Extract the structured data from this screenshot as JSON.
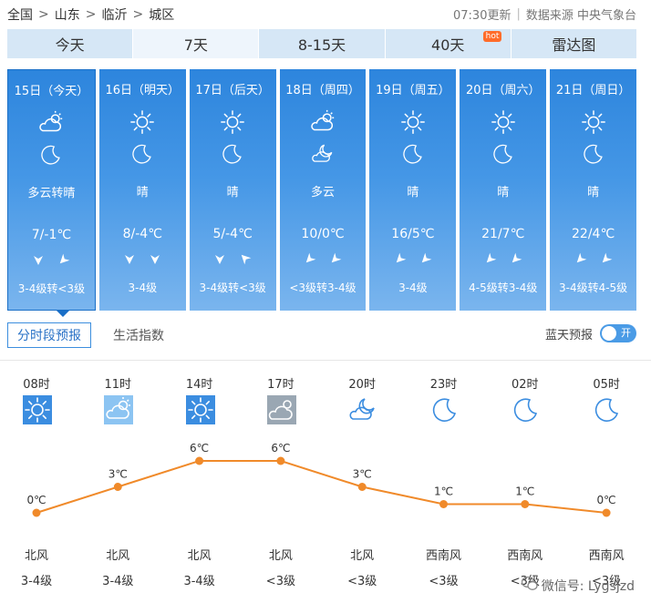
{
  "breadcrumb": {
    "country": "全国",
    "province": "山东",
    "city": "临沂",
    "district": "城区",
    "sep": ">"
  },
  "source": {
    "updated": "07:30更新",
    "text": "数据来源 中央气象台",
    "sep": "|"
  },
  "tabs": [
    {
      "label": "今天"
    },
    {
      "label": "7天"
    },
    {
      "label": "8-15天"
    },
    {
      "label": "40天",
      "badge": "hot"
    },
    {
      "label": "雷达图"
    }
  ],
  "days": [
    {
      "date": "15日（今天）",
      "day_icon": "partly-cloudy-icon",
      "night_icon": "moon-icon",
      "cond": "多云转晴",
      "temp": "7/-1℃",
      "wind_level": "3-4级转<3级"
    },
    {
      "date": "16日（明天）",
      "day_icon": "sun-icon",
      "night_icon": "moon-icon",
      "cond": "晴",
      "temp": "8/-4℃",
      "wind_level": "3-4级"
    },
    {
      "date": "17日（后天）",
      "day_icon": "sun-icon",
      "night_icon": "moon-icon",
      "cond": "晴",
      "temp": "5/-4℃",
      "wind_level": "3-4级转<3级"
    },
    {
      "date": "18日（周四）",
      "day_icon": "partly-cloudy-icon",
      "night_icon": "cloudy-night-icon",
      "cond": "多云",
      "temp": "10/0℃",
      "wind_level": "<3级转3-4级"
    },
    {
      "date": "19日（周五）",
      "day_icon": "sun-icon",
      "night_icon": "moon-icon",
      "cond": "晴",
      "temp": "16/5℃",
      "wind_level": "3-4级"
    },
    {
      "date": "20日（周六）",
      "day_icon": "sun-icon",
      "night_icon": "moon-icon",
      "cond": "晴",
      "temp": "21/7℃",
      "wind_level": "4-5级转3-4级"
    },
    {
      "date": "21日（周日）",
      "day_icon": "sun-icon",
      "night_icon": "moon-icon",
      "cond": "晴",
      "temp": "22/4℃",
      "wind_level": "3-4级转4-5级"
    }
  ],
  "subtabs": [
    {
      "label": "分时段预报"
    },
    {
      "label": "生活指数"
    }
  ],
  "bluesky": {
    "label": "蓝天预报",
    "toggle": "开"
  },
  "hours": [
    {
      "time": "08时",
      "icon": "sun-icon",
      "temp": 0,
      "temp_label": "0℃",
      "dir": "北风",
      "level": "3-4级"
    },
    {
      "time": "11时",
      "icon": "partly-cloudy-icon",
      "temp": 3,
      "temp_label": "3℃",
      "dir": "北风",
      "level": "3-4级"
    },
    {
      "time": "14时",
      "icon": "sun-icon",
      "temp": 6,
      "temp_label": "6℃",
      "dir": "北风",
      "level": "3-4级"
    },
    {
      "time": "17时",
      "icon": "cloudy-icon",
      "temp": 6,
      "temp_label": "6℃",
      "dir": "北风",
      "level": "<3级"
    },
    {
      "time": "20时",
      "icon": "cloudy-night-icon",
      "temp": 3,
      "temp_label": "3℃",
      "dir": "北风",
      "level": "<3级"
    },
    {
      "time": "23时",
      "icon": "moon-icon",
      "temp": 1,
      "temp_label": "1℃",
      "dir": "西南风",
      "level": "<3级"
    },
    {
      "time": "02时",
      "icon": "moon-icon",
      "temp": 1,
      "temp_label": "1℃",
      "dir": "西南风",
      "level": "<3级"
    },
    {
      "time": "05时",
      "icon": "moon-icon",
      "temp": 0,
      "temp_label": "0℃",
      "dir": "西南风",
      "level": "<3级"
    }
  ],
  "watermark": "微信号: Lygsjzd",
  "colors": {
    "accent": "#2d85dd",
    "line": "#f08a2a",
    "tab_bg": "#d6e7f6"
  }
}
